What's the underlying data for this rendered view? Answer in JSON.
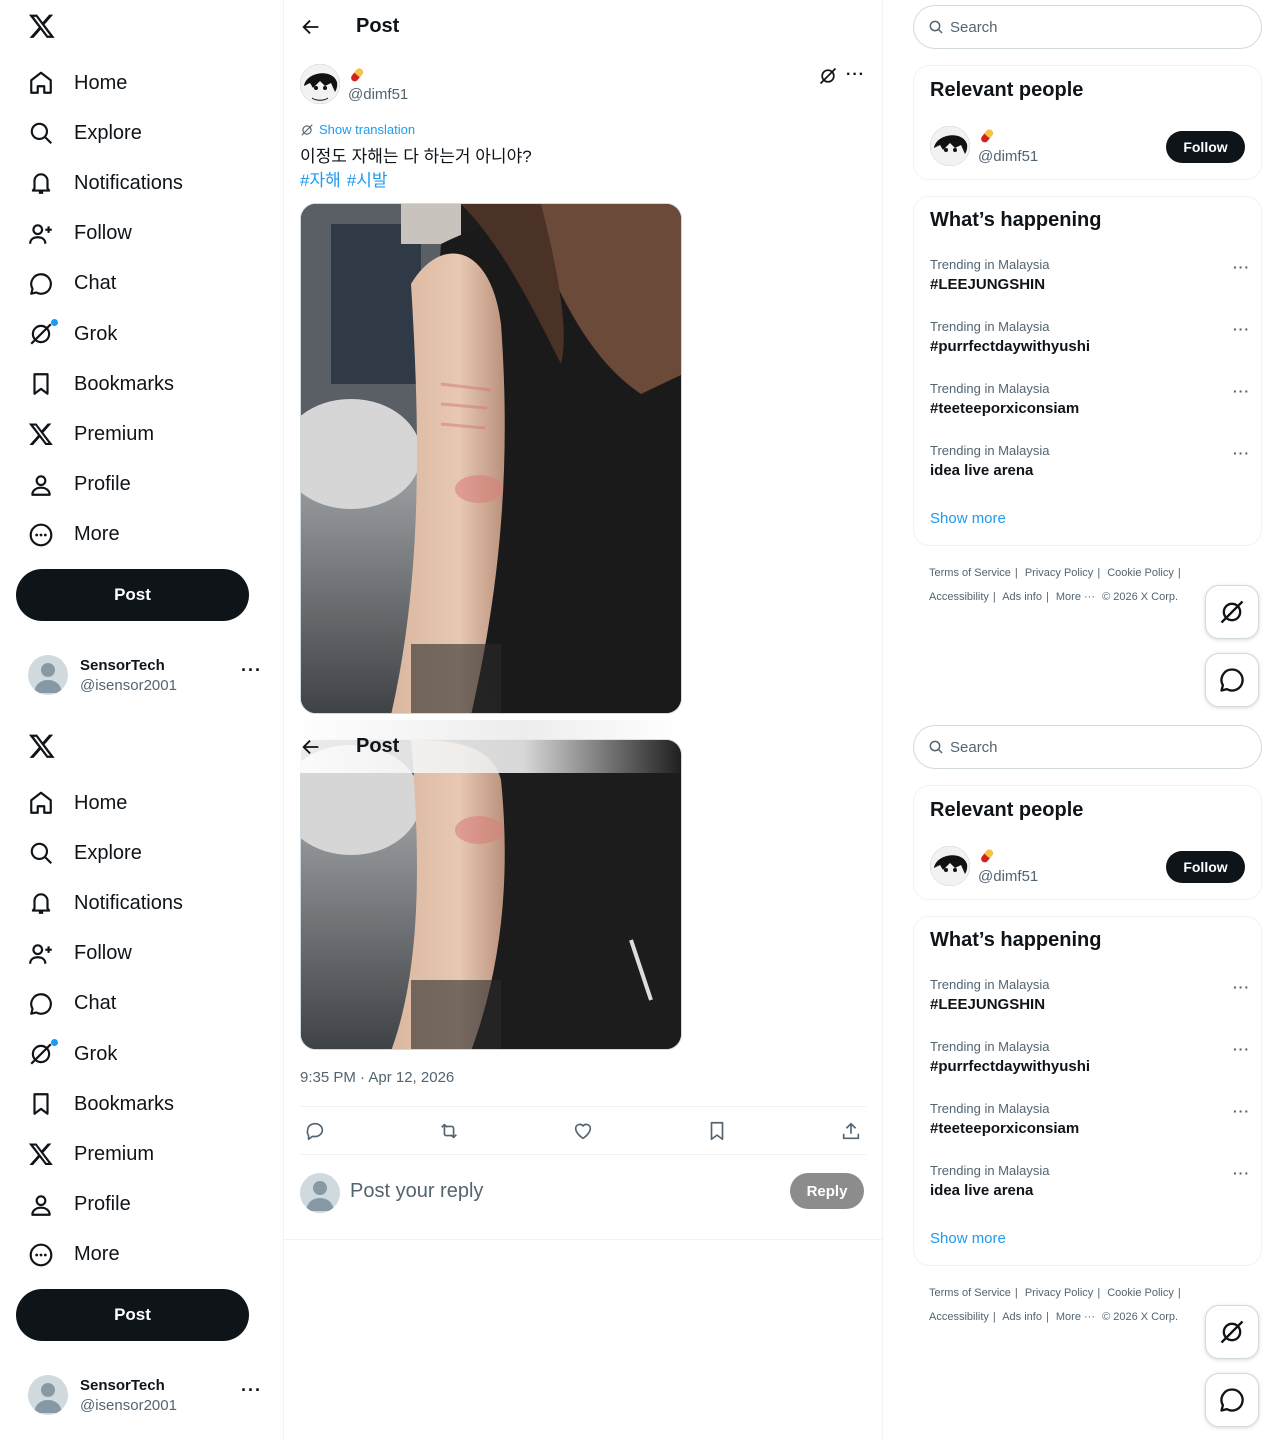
{
  "nav": {
    "items": [
      {
        "label": "Home",
        "icon": "home-icon"
      },
      {
        "label": "Explore",
        "icon": "search-icon"
      },
      {
        "label": "Notifications",
        "icon": "bell-icon"
      },
      {
        "label": "Follow",
        "icon": "add-person-icon"
      },
      {
        "label": "Chat",
        "icon": "chat-icon"
      },
      {
        "label": "Grok",
        "icon": "grok-icon"
      },
      {
        "label": "Bookmarks",
        "icon": "bookmark-icon"
      },
      {
        "label": "Premium",
        "icon": "x-logo-icon"
      },
      {
        "label": "Profile",
        "icon": "person-icon"
      },
      {
        "label": "More",
        "icon": "more-circle-icon"
      }
    ],
    "post_button": "Post"
  },
  "account": {
    "name": "SensorTech",
    "handle": "@isensor2001",
    "more": "···"
  },
  "header": {
    "title": "Post"
  },
  "post": {
    "author_handle": "@dimf51",
    "show_translation": "Show translation",
    "text": "이정도 자해는 다 하는거 아니야?",
    "hashtags": [
      "#자해",
      "#시발"
    ],
    "timestamp": "9:35 PM · Apr 12, 2026",
    "more": "···"
  },
  "reply": {
    "placeholder": "Post your reply",
    "button": "Reply"
  },
  "sidebar": {
    "search_placeholder": "Search",
    "relevant_title": "Relevant people",
    "relevant_handle": "@dimf51",
    "follow": "Follow",
    "happening_title": "What’s happening",
    "trends": [
      {
        "category": "Trending in Malaysia",
        "name": "#LEEJUNGSHIN"
      },
      {
        "category": "Trending in Malaysia",
        "name": "#purrfectdaywithyushi"
      },
      {
        "category": "Trending in Malaysia",
        "name": "#teeteeporxiconsiam"
      },
      {
        "category": "Trending in Malaysia",
        "name": "idea live arena"
      }
    ],
    "trend_more": "···",
    "show_more": "Show more",
    "footer": [
      "Terms of Service",
      "|",
      "Privacy Policy",
      "|",
      "Cookie Policy",
      "|",
      "Accessibility",
      "|",
      "Ads info",
      "|",
      "More ···",
      "© 2026 X Corp."
    ]
  },
  "colors": {
    "accent": "#1d9bf0",
    "text": "#0f1419",
    "secondary": "#536471",
    "button_dark": "#0f1419",
    "reply_disabled": "#8c8c8c"
  }
}
